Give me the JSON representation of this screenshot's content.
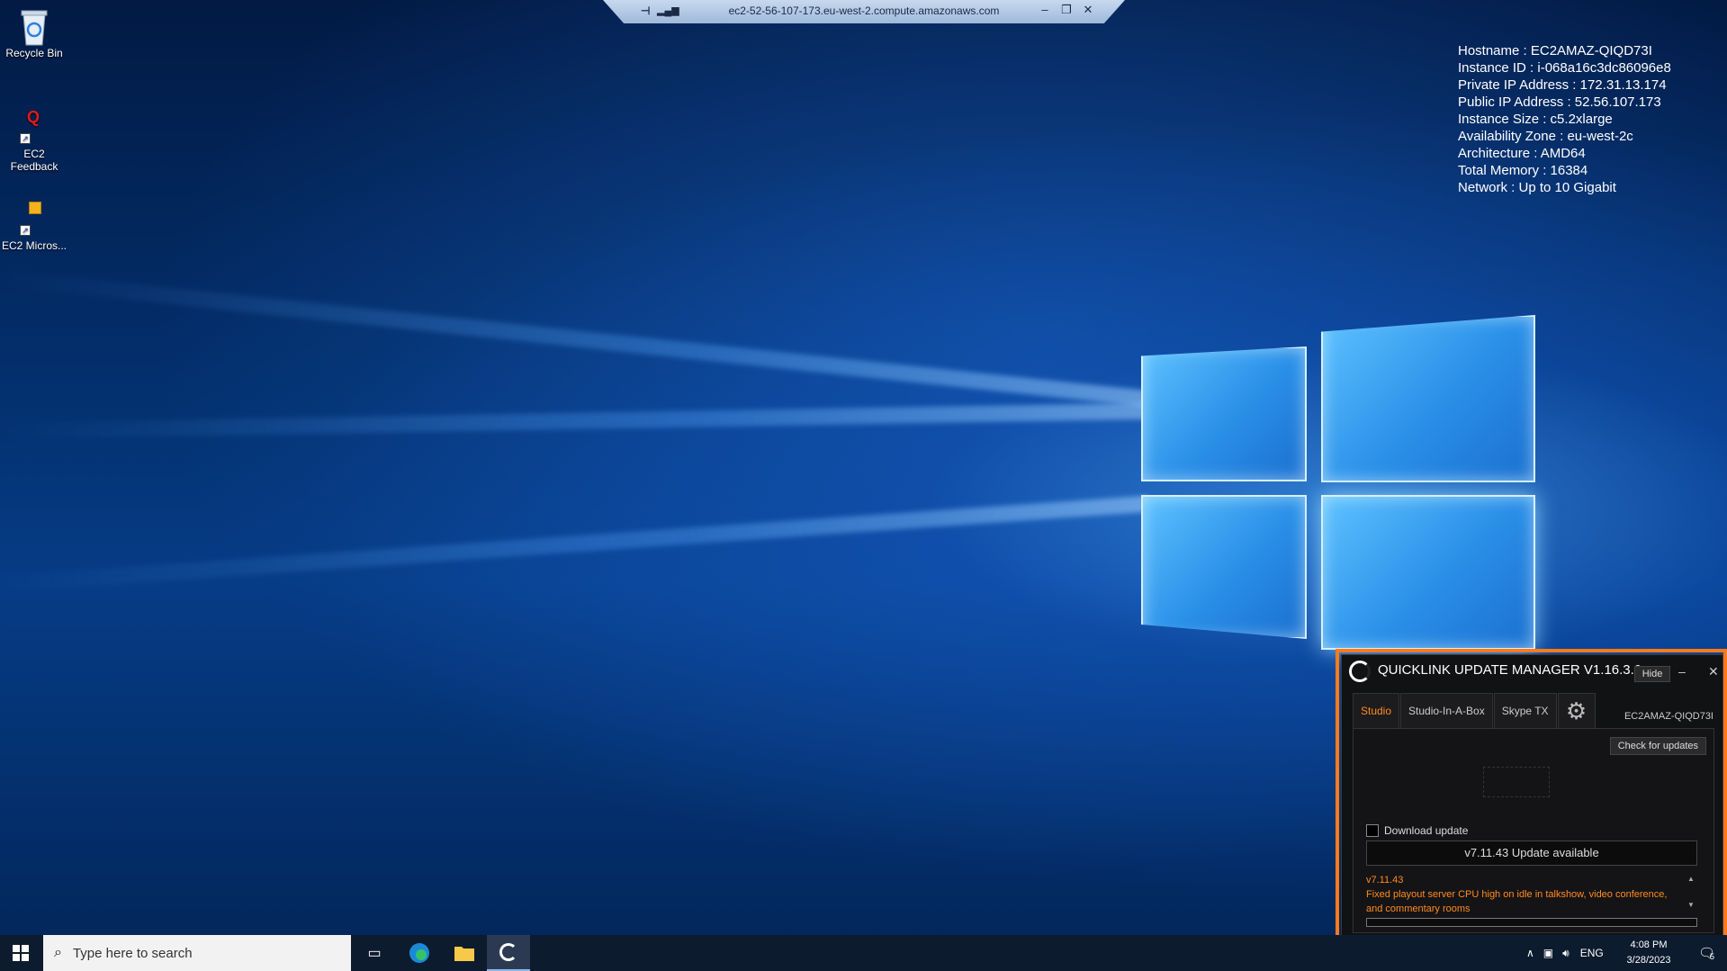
{
  "desktop": {
    "icons": [
      {
        "label": "Recycle Bin",
        "icon": "recycle-bin-icon"
      },
      {
        "label": "EC2 Feedback",
        "icon": "quicklink-q-icon"
      },
      {
        "label": "EC2 Micros...",
        "icon": "package-box-icon"
      }
    ]
  },
  "rdp_bar": {
    "title": "ec2-52-56-107-173.eu-west-2.compute.amazonaws.com",
    "pin_icon": "pin-icon",
    "signal_icon": "connection-signal-icon",
    "minimize": "–",
    "restore": "❐",
    "close": "✕"
  },
  "sysinfo": [
    "Hostname : EC2AMAZ-QIQD73I",
    "Instance ID : i-068a16c3dc86096e8",
    "Private IP Address : 172.31.13.174",
    "Public IP Address : 52.56.107.173",
    "Instance Size : c5.2xlarge",
    "Availability Zone : eu-west-2c",
    "Architecture : AMD64",
    "Total Memory : 16384",
    "Network : Up to 10 Gigabit"
  ],
  "quicklink": {
    "title": "QUICKLINK UPDATE MANAGER V1.16.3.0",
    "hide_label": "Hide",
    "minimize": "–",
    "close": "✕",
    "tabs": [
      {
        "label": "Studio",
        "active": true
      },
      {
        "label": "Studio-In-A-Box",
        "active": false
      },
      {
        "label": "Skype TX",
        "active": false
      }
    ],
    "settings_icon": "gear-icon",
    "hostname": "EC2AMAZ-QIQD73I",
    "check_updates_label": "Check for updates",
    "download_label": "Download update",
    "download_checked": false,
    "status": "v7.11.43 Update available",
    "notes_version": "v7.11.43",
    "notes_text": "Fixed playout server CPU high on idle in talkshow, video conference, and commentary rooms",
    "accent_color": "#ff7a1a"
  },
  "taskbar": {
    "search_placeholder": "Type here to search",
    "apps": [
      "task-view-icon",
      "edge-icon",
      "file-explorer-icon",
      "quicklink-icon"
    ],
    "tray": {
      "language": "ENG",
      "time": "4:08 PM",
      "date": "3/28/2023",
      "notification_count": "5"
    }
  }
}
